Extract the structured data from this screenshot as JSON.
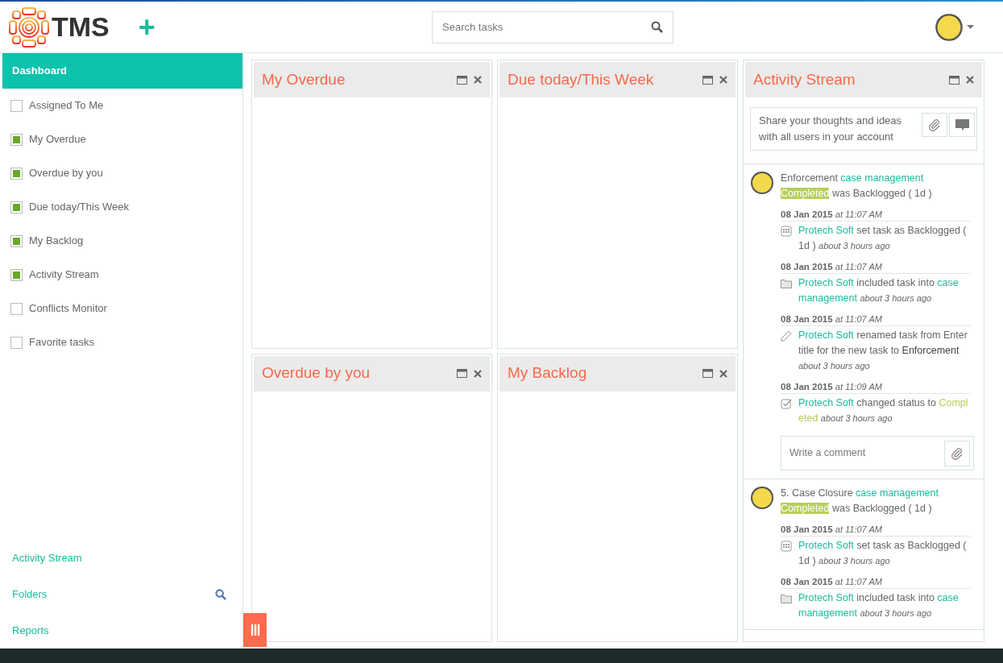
{
  "header": {
    "logo_text": "TMS",
    "add_label": "+",
    "search": {
      "placeholder": "Search tasks"
    }
  },
  "sidebar": {
    "items": [
      {
        "label": "Dashboard",
        "selected": true,
        "kind": "header"
      },
      {
        "label": "Assigned To Me",
        "checked": false,
        "kind": "check"
      },
      {
        "label": "My Overdue",
        "checked": true,
        "kind": "check"
      },
      {
        "label": "Overdue by you",
        "checked": true,
        "kind": "check"
      },
      {
        "label": "Due today/This Week",
        "checked": true,
        "kind": "check"
      },
      {
        "label": "My Backlog",
        "checked": true,
        "kind": "check"
      },
      {
        "label": "Activity Stream",
        "checked": true,
        "kind": "check"
      },
      {
        "label": "Conflicts Monitor",
        "checked": false,
        "kind": "check"
      },
      {
        "label": "Favorite tasks",
        "checked": false,
        "kind": "check"
      }
    ],
    "links": [
      {
        "label": "Activity Stream",
        "search": false
      },
      {
        "label": "Folders",
        "search": true
      },
      {
        "label": "Reports",
        "search": false
      }
    ]
  },
  "widgets": [
    {
      "title": "My Overdue"
    },
    {
      "title": "Due today/This Week"
    },
    {
      "title": "Overdue by you"
    },
    {
      "title": "My Backlog"
    }
  ],
  "activity": {
    "title": "Activity Stream",
    "share_placeholder": "Share your thoughts and ideas with all users in your account",
    "posts": [
      {
        "title": "Enforcement",
        "link": "case management",
        "status": "Completed",
        "rest": "was Backlogged ( 1d )",
        "comment_placeholder": "Write a comment",
        "events": [
          {
            "date": "08 Jan 2015",
            "time": "at 11:07 AM",
            "kind": "calendar",
            "parts": [
              {
                "kind": "link",
                "text": "Protech Soft"
              },
              {
                "kind": "plain",
                "text": "set task as Backlogged ( 1d )"
              }
            ],
            "ago": "about 3 hours ago"
          },
          {
            "date": "08 Jan 2015",
            "time": "at 11:07 AM",
            "kind": "folder",
            "parts": [
              {
                "kind": "link",
                "text": "Protech Soft"
              },
              {
                "kind": "plain",
                "text": "included task into"
              },
              {
                "kind": "link",
                "text": "case management"
              }
            ],
            "ago": "about 3 hours ago"
          },
          {
            "date": "08 Jan 2015",
            "time": "at 11:07 AM",
            "kind": "pencil",
            "parts": [
              {
                "kind": "link",
                "text": "Protech Soft"
              },
              {
                "kind": "plain",
                "text": "renamed task from Enter title for the new task to"
              },
              {
                "kind": "dark",
                "text": "Enforcement"
              }
            ],
            "ago": "about 3 hours ago"
          },
          {
            "date": "08 Jan 2015",
            "time": "at 11:09 AM",
            "kind": "check",
            "parts": [
              {
                "kind": "link",
                "text": "Protech Soft"
              },
              {
                "kind": "plain",
                "text": "changed status to"
              },
              {
                "kind": "status",
                "text": "Completed"
              }
            ],
            "ago": "about 3 hours ago"
          }
        ]
      },
      {
        "title": "5. Case Closure",
        "link": "case management",
        "status": "Completed",
        "rest": "was Backlogged ( 1d )",
        "events": [
          {
            "date": "08 Jan 2015",
            "time": "at 11:07 AM",
            "kind": "calendar",
            "parts": [
              {
                "kind": "link",
                "text": "Protech Soft"
              },
              {
                "kind": "plain",
                "text": "set task as Backlogged ( 1d )"
              }
            ],
            "ago": "about 3 hours ago"
          },
          {
            "date": "08 Jan 2015",
            "time": "at 11:07 AM",
            "kind": "folder",
            "parts": [
              {
                "kind": "link",
                "text": "Protech Soft"
              },
              {
                "kind": "plain",
                "text": "included task into"
              },
              {
                "kind": "link",
                "text": "case management"
              }
            ],
            "ago": "about 3 hours ago"
          }
        ]
      }
    ]
  }
}
